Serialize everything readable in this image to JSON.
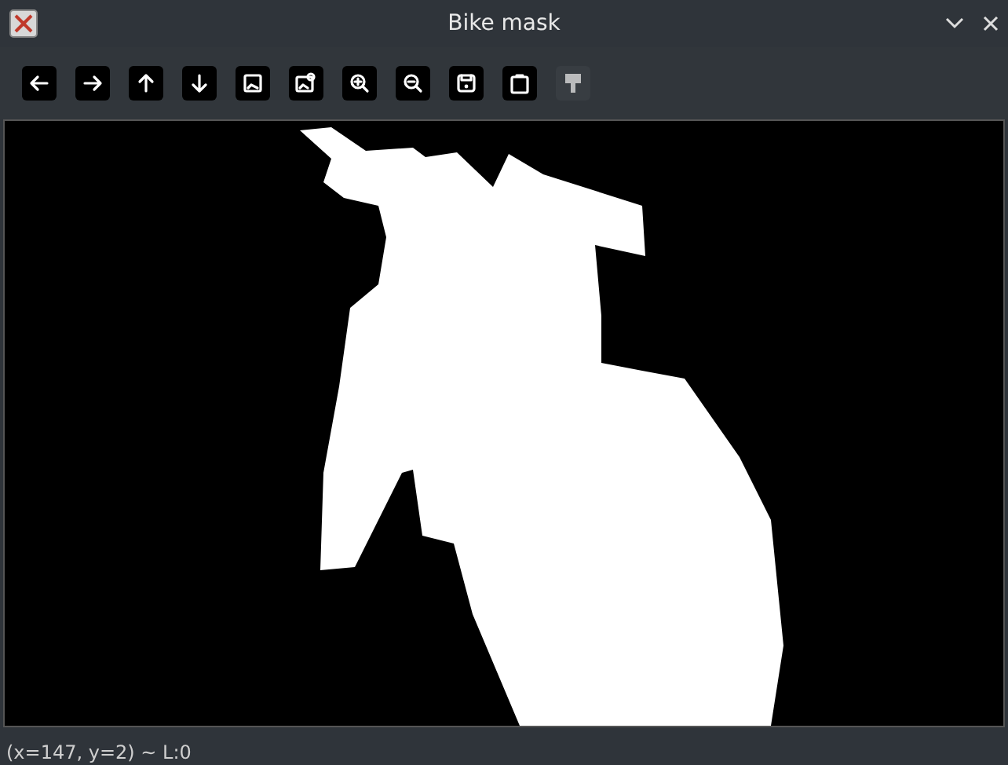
{
  "window": {
    "title": "Bike mask"
  },
  "toolbar": {
    "buttons": [
      {
        "disabled": false
      },
      {
        "disabled": false
      },
      {
        "disabled": false
      },
      {
        "disabled": false
      },
      {
        "disabled": false
      },
      {
        "disabled": false
      },
      {
        "disabled": false
      },
      {
        "disabled": false
      },
      {
        "disabled": false
      },
      {
        "disabled": false
      },
      {
        "disabled": true
      }
    ]
  },
  "status_bar": {
    "text": "(x=147, y=2) ~ L:0"
  }
}
